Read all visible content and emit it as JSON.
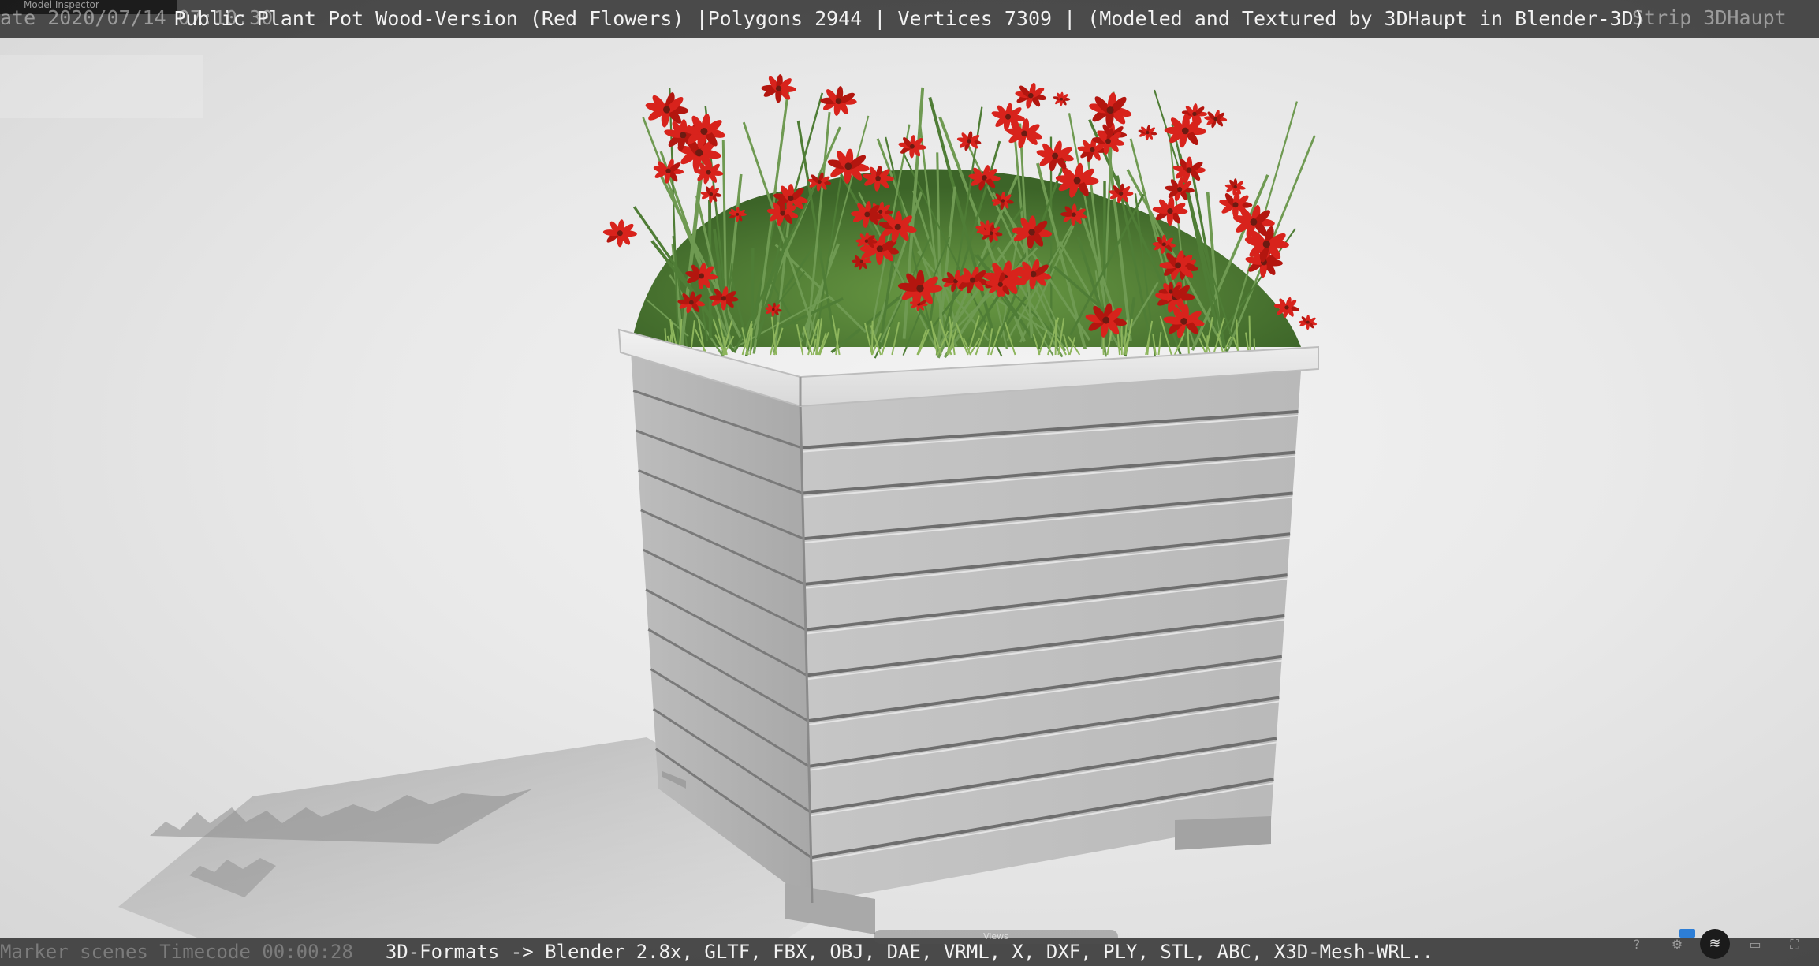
{
  "header": {
    "title": "Public Plant Pot Wood-Version (Red Flowers) |Polygons 2944 | Vertices 7309 | (Modeled and Textured by 3DHaupt in Blender-3D)",
    "ghost_left": "ate 2020/07/14 07:10:30",
    "ghost_right": "Strip 3DHaupt",
    "inspector_label": "Model Inspector"
  },
  "footer": {
    "formats": "3D-Formats -> Blender 2.8x, GLTF, FBX, OBJ, DAE, VRML, X, DXF, PLY, STL, ABC, X3D-Mesh-WRL..",
    "ghost_left": "Marker scenes  Timecode 00:00:28",
    "views_label": "Views"
  },
  "controls": {
    "help_icon": "help-icon",
    "settings_icon": "gear-icon",
    "layers_icon": "layers-icon",
    "vr_icon": "vr-icon",
    "fullscreen_icon": "fullscreen-icon"
  },
  "colors": {
    "bar_bg": "#282828",
    "flower_red": "#d8231c",
    "stem_green": "#4f7d36",
    "pot_wood": "#c9c9c9"
  }
}
